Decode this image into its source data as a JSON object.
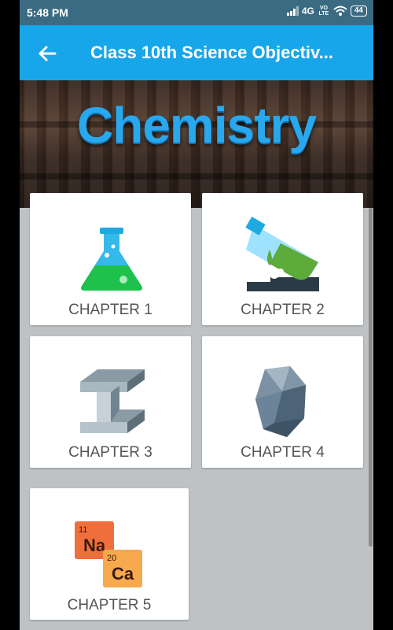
{
  "status_bar": {
    "time": "5:48 PM",
    "network": "4G",
    "volte": "VO LTE",
    "battery": "44"
  },
  "app_bar": {
    "back_icon": "arrow-left-icon",
    "title": "Class 10th Science Objectiv..."
  },
  "banner": {
    "title": "Chemistry"
  },
  "chapters": [
    {
      "label": "CHAPTER 1",
      "icon": "flask-icon"
    },
    {
      "label": "CHAPTER 2",
      "icon": "test-tube-icon"
    },
    {
      "label": "CHAPTER 3",
      "icon": "steel-beam-icon"
    },
    {
      "label": "CHAPTER 4",
      "icon": "rock-icon"
    },
    {
      "label": "CHAPTER 5",
      "icon": "periodic-elements-icon",
      "elements": [
        {
          "number": "11",
          "symbol": "Na"
        },
        {
          "number": "20",
          "symbol": "Ca"
        }
      ]
    }
  ],
  "colors": {
    "app_bar": "#18a6ea",
    "status_bar": "#3a6b82",
    "banner_text": "#29a8ee"
  }
}
